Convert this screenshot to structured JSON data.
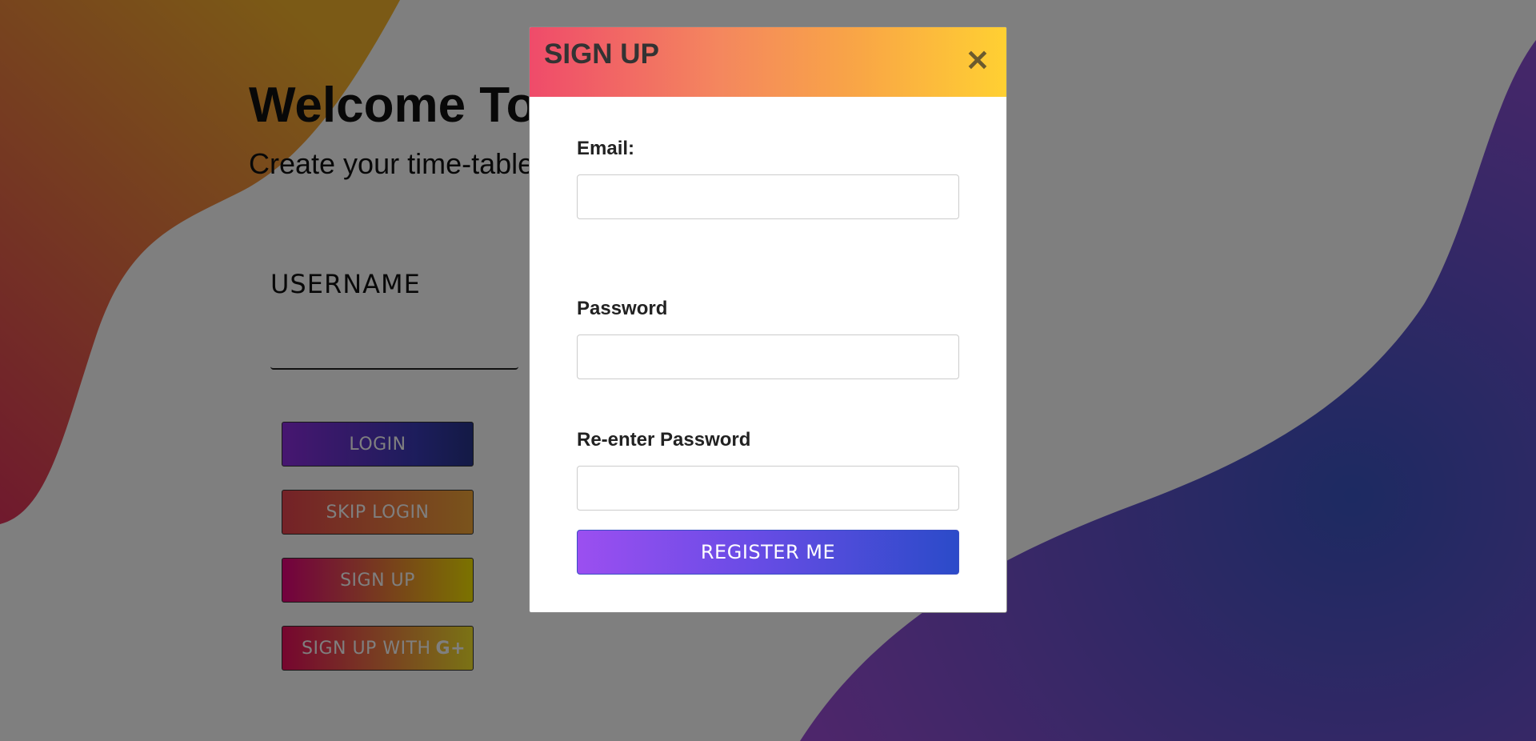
{
  "background": {
    "welcome_title": "Welcome To",
    "welcome_subtitle": "Create your time-table",
    "username_label": "USERNAME",
    "buttons": {
      "login": "LOGIN",
      "skip_login": "SKIP LOGIN",
      "sign_up": "SIGN UP",
      "sign_up_with": "SIGN UP WITH",
      "google_glyph": "G+"
    }
  },
  "modal": {
    "title": "SIGN UP",
    "close_glyph": "✕",
    "email_label": "Email:",
    "password_label": "Password",
    "reenter_label": "Re-enter Password",
    "register_label": "REGISTER ME"
  },
  "colors": {
    "overlay": "#808080",
    "header_gradient_start": "#ef4b6a",
    "header_gradient_end": "#ffd032",
    "register_gradient_start": "#9b4ff0",
    "register_gradient_end": "#2b4bc9"
  }
}
